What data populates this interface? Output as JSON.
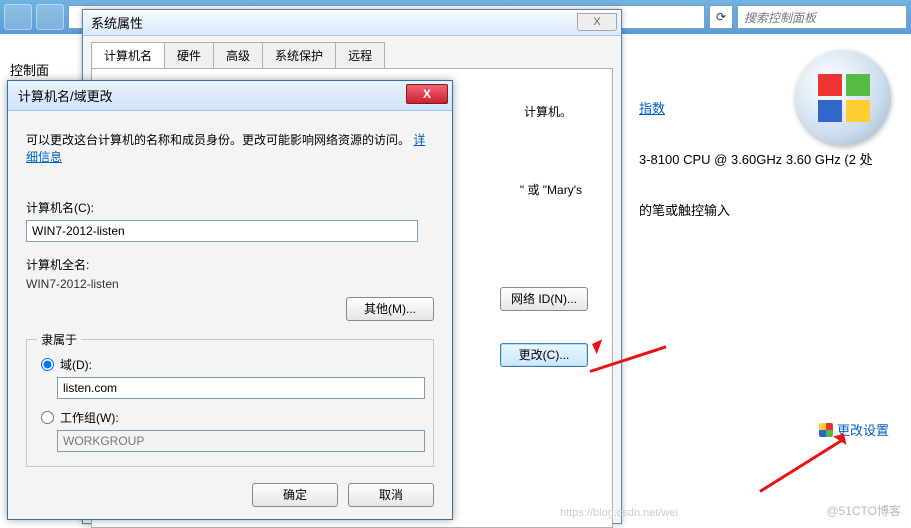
{
  "topbar": {
    "search_placeholder": "搜索控制面板",
    "refresh_glyph": "⟳"
  },
  "sidebar_label": "控制面",
  "sysprops": {
    "title": "系统属性",
    "close_glyph": "X",
    "tabs": [
      "计算机名",
      "硬件",
      "高级",
      "系统保护",
      "远程"
    ],
    "computer_suffix": "计算机。",
    "example_suffix": "\" 或 \"Mary's",
    "btn_network_id": "网络 ID(N)...",
    "btn_change": "更改(C)...",
    "btn_other": "其他(M)..."
  },
  "namedlg": {
    "title": "计算机名/域更改",
    "close_glyph": "X",
    "desc1": "可以更改这台计算机的名称和成员身份。更改可能影响网络资源的访问。",
    "details_link": "详细信息",
    "label_computer_name": "计算机名(C):",
    "computer_name_value": "WIN7-2012-listen",
    "label_full_name": "计算机全名:",
    "full_name_value": "WIN7-2012-listen",
    "group_title": "隶属于",
    "radio_domain": "域(D):",
    "domain_value": "listen.com",
    "radio_workgroup": "工作组(W):",
    "workgroup_value": "WORKGROUP",
    "btn_ok": "确定",
    "btn_cancel": "取消"
  },
  "rightpane": {
    "index_label": "指数",
    "cpu_text": "3-8100 CPU @ 3.60GHz   3.60 GHz  (2 处",
    "pen_text": "的笔或触控输入",
    "change_settings": "更改设置"
  },
  "watermark": "@51CTO博客",
  "watermark2": "https://blog.csdn.net/wei"
}
